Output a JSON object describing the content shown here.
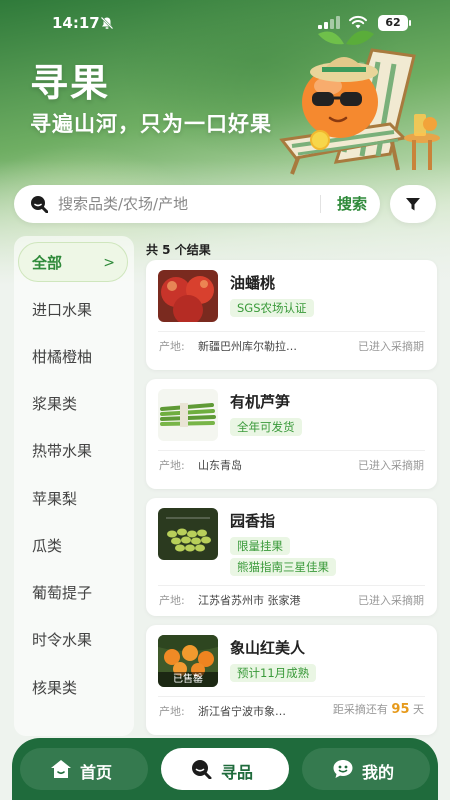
{
  "status_bar": {
    "time": "14:17",
    "battery": "62"
  },
  "hero": {
    "title": "寻果",
    "slogan": "寻遍山河，只为一口好果"
  },
  "search": {
    "placeholder": "搜索品类/农场/产地",
    "value": "",
    "button_label": "搜索"
  },
  "sidebar": {
    "items": [
      {
        "label": "全部"
      },
      {
        "label": "进口水果"
      },
      {
        "label": "柑橘橙柚"
      },
      {
        "label": "浆果类"
      },
      {
        "label": "热带水果"
      },
      {
        "label": "苹果梨"
      },
      {
        "label": "瓜类"
      },
      {
        "label": "葡萄提子"
      },
      {
        "label": "时令水果"
      },
      {
        "label": "核果类"
      }
    ],
    "active_index": 0
  },
  "results": {
    "count_text": "共 5 个结果",
    "origin_label": "产地:",
    "items": [
      {
        "name": "油蟠桃",
        "tags": [
          "SGS农场认证"
        ],
        "origin": "新疆巴州库尔勒拉…",
        "status": "已进入采摘期"
      },
      {
        "name": "有机芦笋",
        "tags": [
          "全年可发货"
        ],
        "origin": "山东青岛",
        "status": "已进入采摘期"
      },
      {
        "name": "园香指",
        "tags": [
          "限量挂果",
          "熊猫指南三星佳果"
        ],
        "origin": "江苏省苏州市 张家港",
        "status": "已进入采摘期"
      },
      {
        "name": "象山红美人",
        "tags": [
          "预计11月成熟"
        ],
        "origin": "浙江省宁波市象…",
        "status_prefix": "距采摘还有",
        "status_days": "95",
        "status_suffix": "天",
        "badge": "已售罄"
      }
    ]
  },
  "nav": {
    "items": [
      {
        "label": "首页",
        "icon": "home-icon"
      },
      {
        "label": "寻品",
        "icon": "search-icon"
      },
      {
        "label": "我的",
        "icon": "chat-icon"
      }
    ],
    "active_index": 1
  },
  "colors": {
    "accent": "#2f8a3a",
    "nav_bg": "#1f6b3c",
    "tag_bg": "#eaf6e4",
    "highlight": "#e69a1c"
  }
}
